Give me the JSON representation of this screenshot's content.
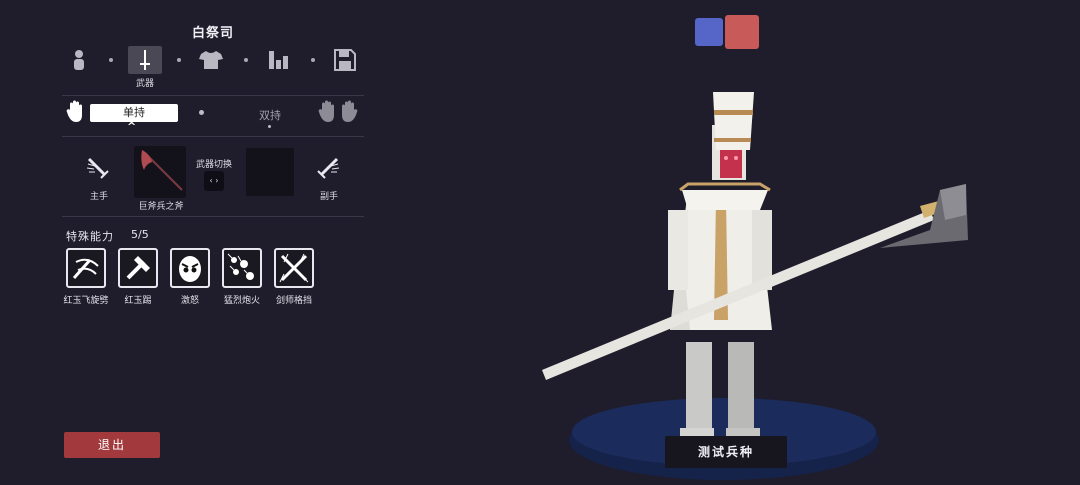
{
  "unit": {
    "name": "白祭司"
  },
  "tabs": [
    {
      "icon": "person-icon",
      "label": ""
    },
    {
      "icon": "sword-icon",
      "label": "武器",
      "active": true
    },
    {
      "icon": "shirt-icon",
      "label": ""
    },
    {
      "icon": "bars-icon",
      "label": ""
    },
    {
      "icon": "save-icon",
      "label": ""
    }
  ],
  "grip": {
    "single": "单持",
    "dual": "双持"
  },
  "weapons": {
    "main_label": "主手",
    "off_label": "副手",
    "main_slot_item": "巨斧兵之斧",
    "swap_label": "武器切换",
    "swap_glyph": "‹ ›"
  },
  "abilities": {
    "title": "特殊能力",
    "count": "5/5",
    "items": [
      {
        "name": "红玉飞旋劈",
        "icon": "spin-slash-icon"
      },
      {
        "name": "红玉踢",
        "icon": "kick-icon"
      },
      {
        "name": "激怒",
        "icon": "angry-face-icon"
      },
      {
        "name": "猛烈炮火",
        "icon": "barrage-icon"
      },
      {
        "name": "剑师格挡",
        "icon": "crossed-swords-icon"
      }
    ]
  },
  "exit_label": "退出",
  "test_button_label": "测试兵种",
  "team_colors": {
    "blue": "#5566c8",
    "red": "#c95a5a"
  }
}
